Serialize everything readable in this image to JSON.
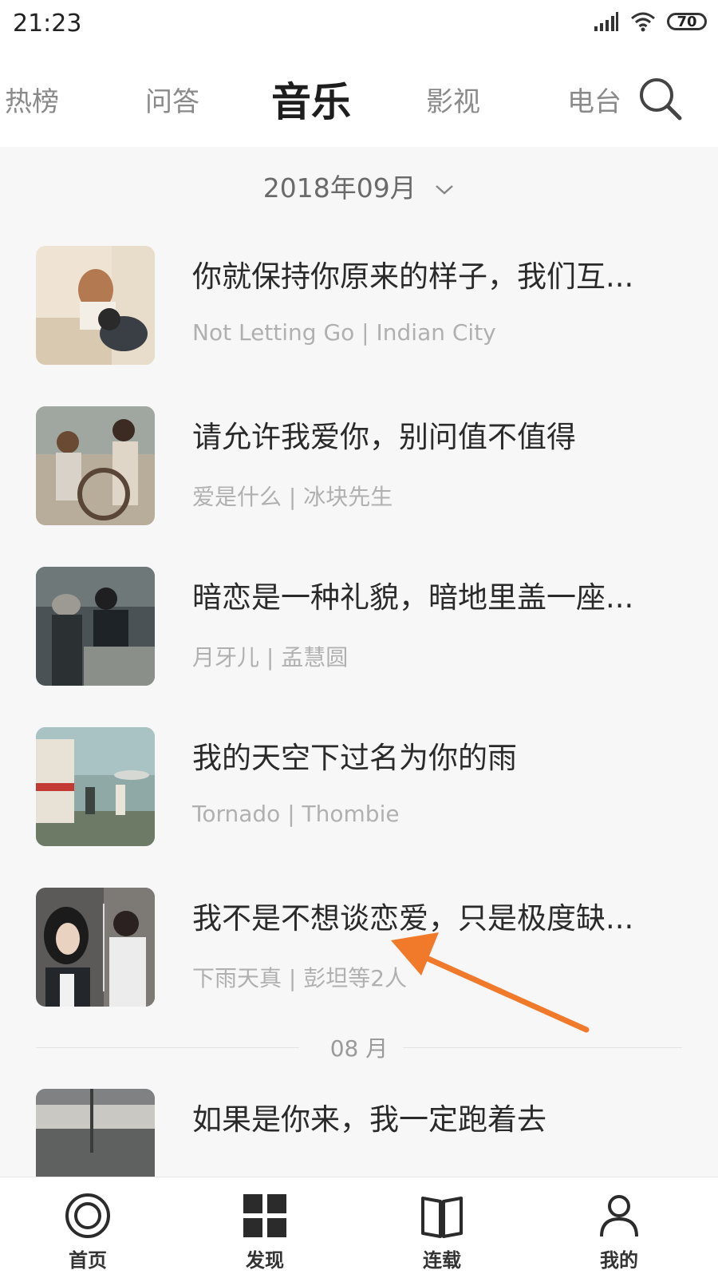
{
  "status_bar": {
    "time": "21:23",
    "battery": "70"
  },
  "top_nav": {
    "tabs": [
      "热榜",
      "问答",
      "音乐",
      "影视",
      "电台"
    ],
    "active": "音乐"
  },
  "month_selector": {
    "label": "2018年09月"
  },
  "list_items": [
    {
      "title": "你就保持你原来的样子，我们互...",
      "subtitle": "Not Letting Go | Indian City"
    },
    {
      "title": "请允许我爱你，别问值不值得",
      "subtitle": "爱是什么 | 冰块先生"
    },
    {
      "title": "暗恋是一种礼貌，暗地里盖一座...",
      "subtitle": "月牙儿 | 孟慧圆"
    },
    {
      "title": "我的天空下过名为你的雨",
      "subtitle": "Tornado | Thombie"
    },
    {
      "title": "我不是不想谈恋爱，只是极度缺...",
      "subtitle": "下雨天真 | 彭坦等2人"
    }
  ],
  "section_divider": {
    "label": "08 月"
  },
  "list_items_aug": [
    {
      "title": "如果是你来，我一定跑着去"
    }
  ],
  "bottom_nav": {
    "items": [
      "首页",
      "发现",
      "连载",
      "我的"
    ]
  },
  "colors": {
    "accent_arrow": "#f07a2a",
    "background": "#f7f7f7",
    "active_text": "#1e1e1e"
  }
}
